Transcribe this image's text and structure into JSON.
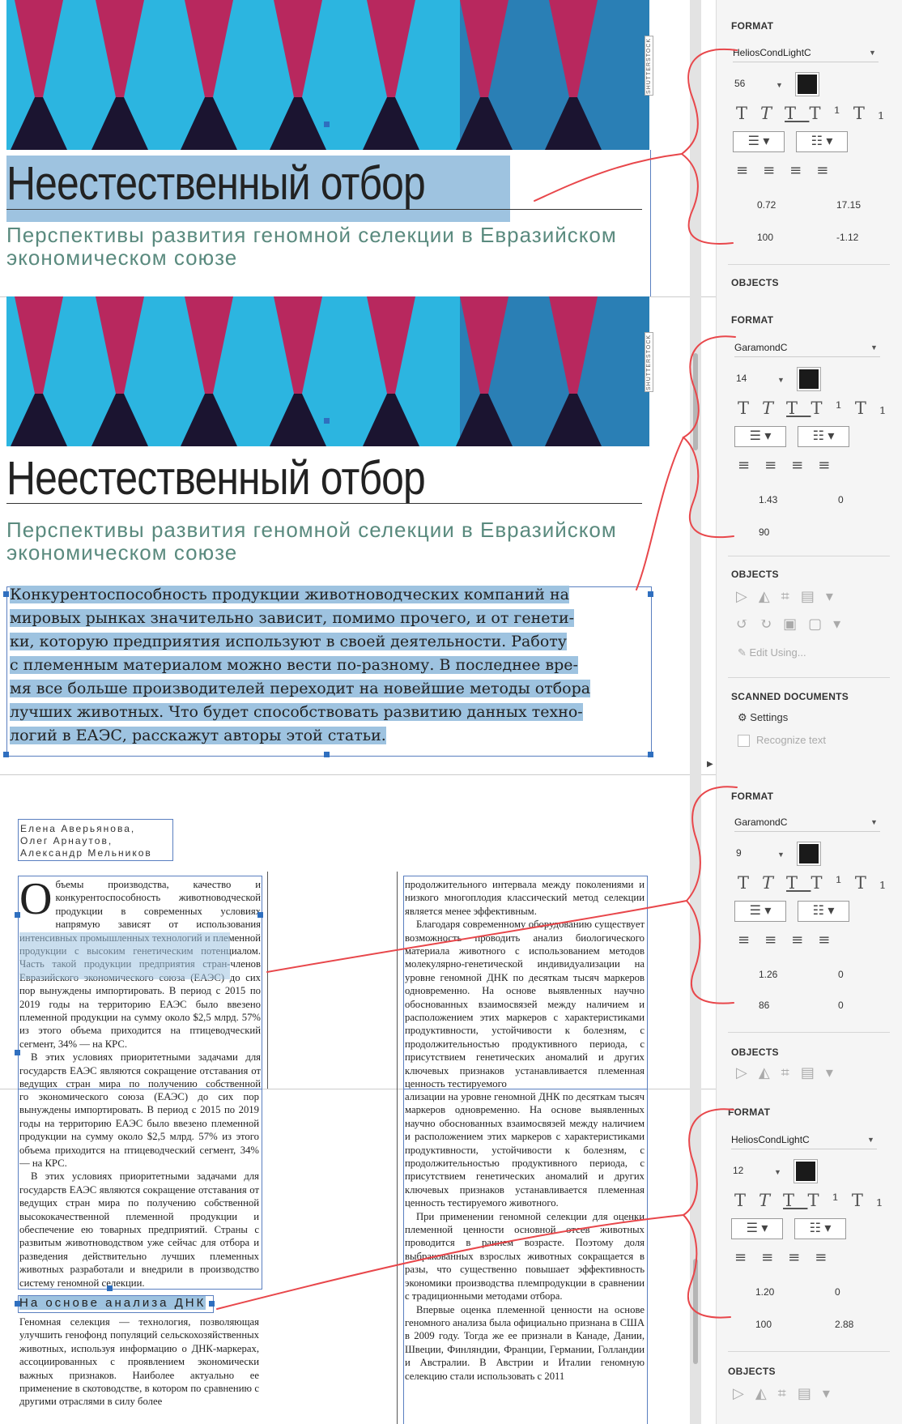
{
  "panels": [
    {
      "format_label": "FORMAT",
      "font": "HeliosCondLightC",
      "size": "56",
      "leading": "0.72",
      "space": "17.15",
      "scale": "100",
      "tracking": "-1.12",
      "objects_label": "OBJECTS"
    },
    {
      "format_label": "FORMAT",
      "font": "GaramondC",
      "size": "14",
      "leading": "1.43",
      "space": "0",
      "scale": "90",
      "tracking": "",
      "objects_label": "OBJECTS",
      "scanned_label": "SCANNED DOCUMENTS",
      "settings_label": "Settings",
      "recognize_label": "Recognize text",
      "edit_using_label": "Edit Using..."
    },
    {
      "format_label": "FORMAT",
      "font": "GaramondC",
      "size": "9",
      "leading": "1.26",
      "space": "0",
      "scale": "86",
      "tracking": "0",
      "objects_label": "OBJECTS"
    },
    {
      "format_label": "FORMAT",
      "font": "HeliosCondLightC",
      "size": "12",
      "leading": "1.20",
      "space": "0",
      "scale": "100",
      "tracking": "2.88",
      "objects_label": "OBJECTS"
    }
  ],
  "article": {
    "photo_credit": "SHUTTERSTOCK",
    "title": "Неестественный отбор",
    "subtitle_line1": "Перспективы развития геномной селекции в Евразийском",
    "subtitle_line2": "экономическом союзе",
    "lede_lines": [
      "Конкурентоспособность продукции животноводческих компаний на",
      "мировых рынках значительно зависит, помимо прочего, и от генети-",
      "ки, которую предприятия используют в своей деятельности. Работу",
      "с племенным материалом можно вести по-разному. В последнее вре-",
      "мя все больше производителей переходит на новейшие методы отбора",
      "лучших животных. Что будет способствовать развитию данных техно-",
      "логий в ЕАЭС, расскажут авторы этой статьи."
    ],
    "authors": [
      "Елена Аверьянова,",
      "Олег Арнаутов,",
      "Александр Мельников"
    ],
    "subhead": "На основе анализа ДНК",
    "dropcap": "О",
    "left_col_a": [
      "бъемы производства, качество и конкурентоспособность животноводческой продукции в современных условиях напрямую зависят от использования интенсивных промышленных технологий и племенной продукции с высоким генетическим потенциалом. Часть такой продукции предприятия стран-членов Евразийского экономического союза (ЕАЭС) до сих пор вынуждены импортировать. В период с 2015 по 2019 годы на территорию ЕАЭС было ввезено племенной продукции на сумму около $2,5 млрд. 57% из этого объема приходится на птицеводческий сегмент, 34% — на КРС.",
      "В этих условиях приоритетными задачами для государств ЕАЭС являются сокращение отставания от ведущих стран мира по получению собственной высококачественной племенной продукции"
    ],
    "left_col_b": [
      "го экономического союза (ЕАЭС) до сих пор вынуждены импортировать. В период с 2015 по 2019 годы на территорию ЕАЭС было ввезено племенной продукции на сумму около $2,5 млрд. 57% из этого объема приходится на птицеводческий сегмент, 34% — на КРС.",
      "В этих условиях приоритетными задачами для государств ЕАЭС являются сокращение отставания от ведущих стран мира по получению собственной высококачественной племенной продукции и обеспечение ею товарных предприятий. Страны с развитым животноводством уже сейчас для отбора и разведения действительно лучших племенных животных разработали и внедрили в производство систему геномной селекции."
    ],
    "left_col_c": "Геномная селекция — технология, позволяющая улучшить генофонд популяций сельскохозяйственных животных, используя информацию о ДНК-маркерах, ассоциированных с проявлением экономически важных признаков. Наиболее актуально ее применение в скотоводстве, в котором по сравнению с другими отраслями в силу более",
    "right_col_a": [
      "продолжительного интервала между поколениями и низкого многоплодия классический метод селекции является менее эффективным.",
      "Благодаря современному оборудованию существует возможность проводить анализ биологического материала животного с использованием методов молекулярно-генетической индивидуализации на уровне геномной ДНК по десяткам тысяч маркеров одновременно. На основе выявленных научно обоснованных взаимосвязей между наличием и расположением этих маркеров с характеристиками продуктивности, устойчивости к болезням, с продолжительностью продуктивного периода, с присутствием генетических аномалий и других ключевых признаков устанавливается племенная ценность тестируемого"
    ],
    "right_col_b": [
      "ализации на уровне геномной ДНК по десяткам тысяч маркеров одновременно. На основе выявленных научно обоснованных взаимосвязей между наличием и расположением этих маркеров с характеристиками продуктивности, устойчивости к болезням, с продолжительностью продуктивного периода, с присутствием генетических аномалий и других ключевых признаков устанавливается племенная ценность тестируемого животного.",
      "При применении геномной селекции для оценки племенной ценности основной отсев животных проводится в раннем возрасте. Поэтому доля выбракованных взрослых животных сокращается в разы, что существенно повышает эффективность экономики производства племпродукции в сравнении с традиционными методами отбора.",
      "Впервые оценка племенной ценности на основе геномного анализа была официально признана в США в 2009 году. Тогда же ее признали в Канаде, Дании, Швеции, Финляндии, Франции, Германии, Голландии и Австралии. В Австрии и Италии геномную селекцию стали использовать с 2011"
    ]
  },
  "colors": {
    "accent": "#2f6fbf",
    "selection": "#9ec3e0",
    "annotation": "#e8474b",
    "subtitle": "#5a8a7e"
  }
}
